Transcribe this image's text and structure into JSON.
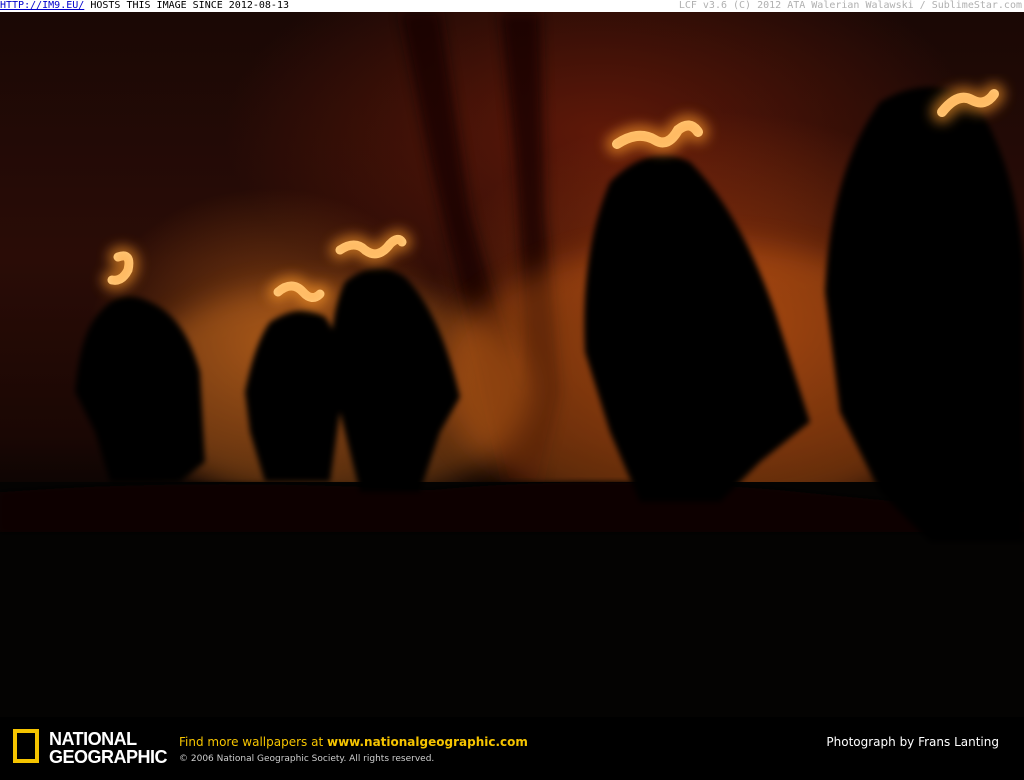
{
  "topbar": {
    "link": "HTTP://IM9.EU/",
    "hosts_text": " HOSTS THIS IMAGE SINCE 2012-08-13",
    "right_text": "LCF v3.6 (C) 2012 ATA Walerian Walawski / SublimeStar.com"
  },
  "photo": {
    "subject": "silhouetted figures with headlamps walking through smoky orange-lit forest at night",
    "colors": {
      "glow": "#ff9a2a",
      "lamp": "#ffe8b0",
      "shadow": "#050302"
    }
  },
  "footer": {
    "logo_line1": "NATIONAL",
    "logo_line2": "GEOGRAPHIC",
    "promo_prefix": "Find more wallpapers at ",
    "promo_url": "www.nationalgeographic.com",
    "copyright": "© 2006 National Geographic Society. All rights reserved.",
    "credit": "Photograph by Frans Lanting",
    "brand_color": "#f5c400"
  }
}
